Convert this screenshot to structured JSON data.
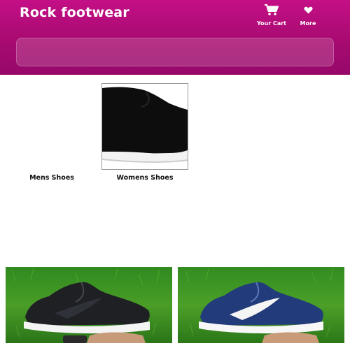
{
  "header": {
    "brand": "Rock footwear",
    "cart_label": "Your Cart",
    "cart_icon": "cart-icon",
    "more_label": "More",
    "more_icon": "heart-icon",
    "search_placeholder": ""
  },
  "categories": [
    {
      "label": "Mens Shoes"
    },
    {
      "label": "Womens Shoes"
    }
  ],
  "colors": {
    "header_top": "#c40f86",
    "header_bottom": "#97086a",
    "text": "#111111"
  }
}
